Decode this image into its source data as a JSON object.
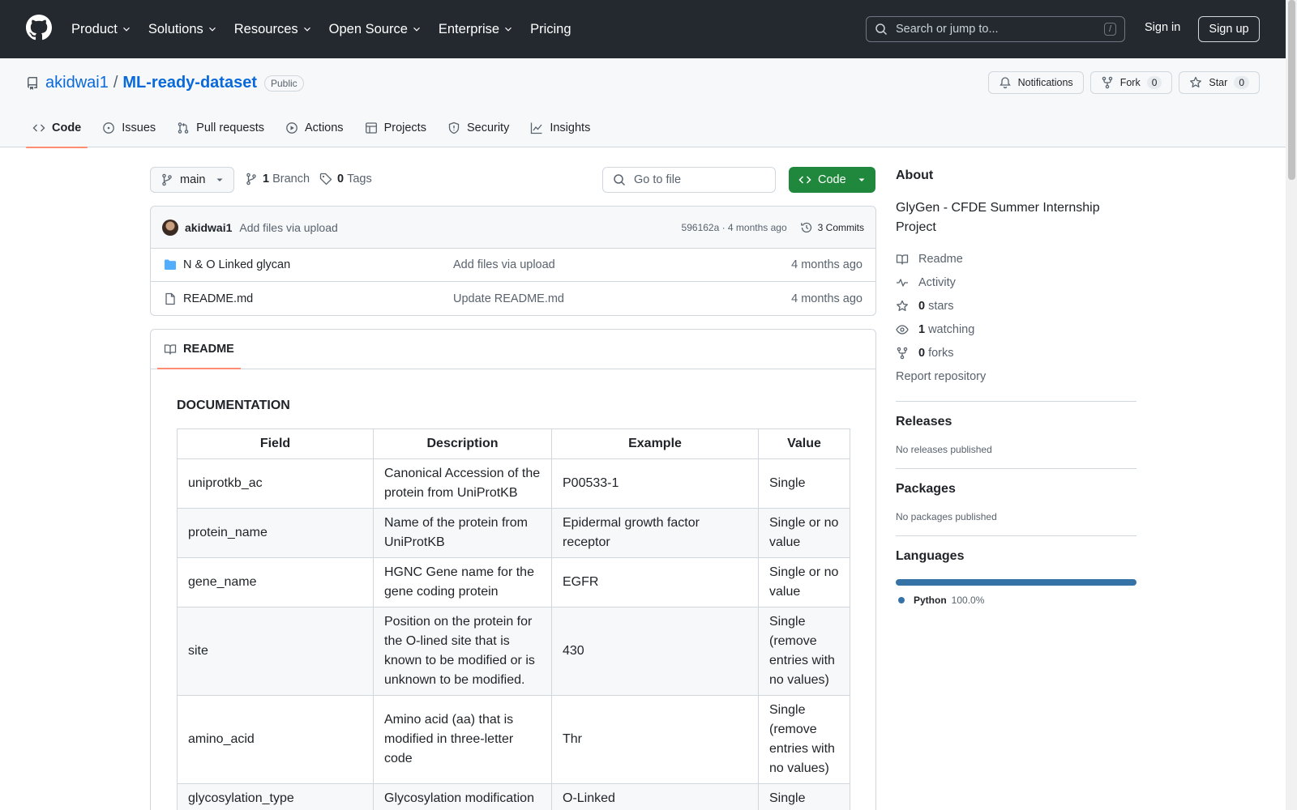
{
  "header": {
    "nav": [
      {
        "label": "Product"
      },
      {
        "label": "Solutions"
      },
      {
        "label": "Resources"
      },
      {
        "label": "Open Source"
      },
      {
        "label": "Enterprise"
      },
      {
        "label": "Pricing"
      }
    ],
    "search_placeholder": "Search or jump to...",
    "search_shortcut": "/",
    "signin": "Sign in",
    "signup": "Sign up"
  },
  "repo": {
    "owner": "akidwai1",
    "separator": "/",
    "name": "ML-ready-dataset",
    "visibility": "Public",
    "notifications": "Notifications",
    "fork_label": "Fork",
    "fork_count": "0",
    "star_label": "Star",
    "star_count": "0",
    "tabs": [
      {
        "label": "Code",
        "icon": "code-icon"
      },
      {
        "label": "Issues",
        "icon": "issue-icon"
      },
      {
        "label": "Pull requests",
        "icon": "pull-request-icon"
      },
      {
        "label": "Actions",
        "icon": "play-icon"
      },
      {
        "label": "Projects",
        "icon": "table-icon"
      },
      {
        "label": "Security",
        "icon": "shield-icon"
      },
      {
        "label": "Insights",
        "icon": "graph-icon"
      }
    ]
  },
  "toolbar": {
    "branch": "main",
    "branch_count": "1",
    "branch_label": "Branch",
    "tag_count": "0",
    "tag_label": "Tags",
    "goto_placeholder": "Go to file",
    "code_button": "Code"
  },
  "commit": {
    "author": "akidwai1",
    "message": "Add files via upload",
    "sha_time": "596162a · 4 months ago",
    "commits": "3 Commits"
  },
  "files": [
    {
      "name": "N & O Linked glycan",
      "type": "folder",
      "message": "Add files via upload",
      "date": "4 months ago"
    },
    {
      "name": "README.md",
      "type": "file",
      "message": "Update README.md",
      "date": "4 months ago"
    }
  ],
  "readme": {
    "tab": "README",
    "heading": "DOCUMENTATION",
    "columns": [
      "Field",
      "Description",
      "Example",
      "Value"
    ],
    "rows": [
      [
        "uniprotkb_ac",
        "Canonical Accession of the protein from UniProtKB",
        "P00533-1",
        "Single"
      ],
      [
        "protein_name",
        "Name of the protein from UniProtKB",
        "Epidermal growth factor receptor",
        "Single or no value"
      ],
      [
        "gene_name",
        "HGNC Gene name for the gene coding protein",
        "EGFR",
        "Single or no value"
      ],
      [
        "site",
        "Position on the protein for the O-lined site that is known to be modified or is unknown to be modified.",
        "430",
        "Single (remove entries with no values)"
      ],
      [
        "amino_acid",
        "Amino acid (aa) that is modified in three-letter code",
        "Thr",
        "Single (remove entries with no values)"
      ],
      [
        "glycosylation_type",
        "Glycosylation modification",
        "O-Linked",
        "Single"
      ]
    ]
  },
  "about": {
    "heading": "About",
    "description": "GlyGen - CFDE Summer Internship Project",
    "readme": "Readme",
    "activity": "Activity",
    "stars_count": "0",
    "stars_label": "stars",
    "watching_count": "1",
    "watching_label": "watching",
    "forks_count": "0",
    "forks_label": "forks",
    "report": "Report repository"
  },
  "releases": {
    "heading": "Releases",
    "note": "No releases published"
  },
  "packages": {
    "heading": "Packages",
    "note": "No packages published"
  },
  "languages": {
    "heading": "Languages",
    "items": [
      {
        "name": "Python",
        "percent": "100.0%",
        "color": "#3572A5",
        "fraction": 1.0
      }
    ]
  },
  "colors": {
    "accent": "#0969da",
    "primary_button": "#1f883d",
    "header_bg": "#24292f",
    "tab_underline": "#fd8c73"
  }
}
